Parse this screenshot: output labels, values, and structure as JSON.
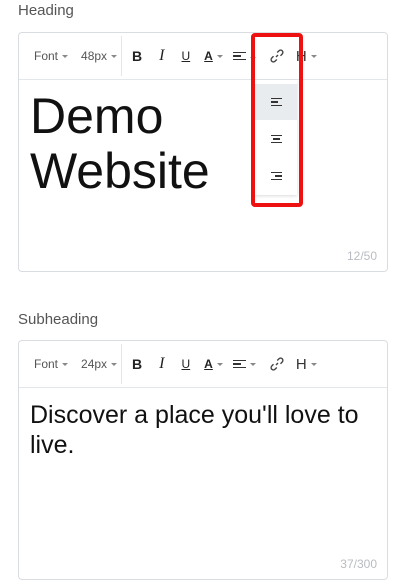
{
  "heading": {
    "label": "Heading",
    "toolbar": {
      "font_label": "Font",
      "size_label": "48px",
      "bold": "B",
      "italic": "I",
      "underline": "U",
      "color": "A",
      "header": "H"
    },
    "content": "Demo Website",
    "counter": "12/50",
    "align_dropdown": {
      "open": true,
      "options": [
        "align-left-icon",
        "align-center-icon",
        "align-right-icon"
      ],
      "selected": "align-left"
    }
  },
  "subheading": {
    "label": "Subheading",
    "toolbar": {
      "font_label": "Font",
      "size_label": "24px",
      "bold": "B",
      "italic": "I",
      "underline": "U",
      "color": "A",
      "header": "H"
    },
    "content": "Discover a place you'll love to live.",
    "counter": "37/300"
  },
  "highlight_color": "#ee1111"
}
